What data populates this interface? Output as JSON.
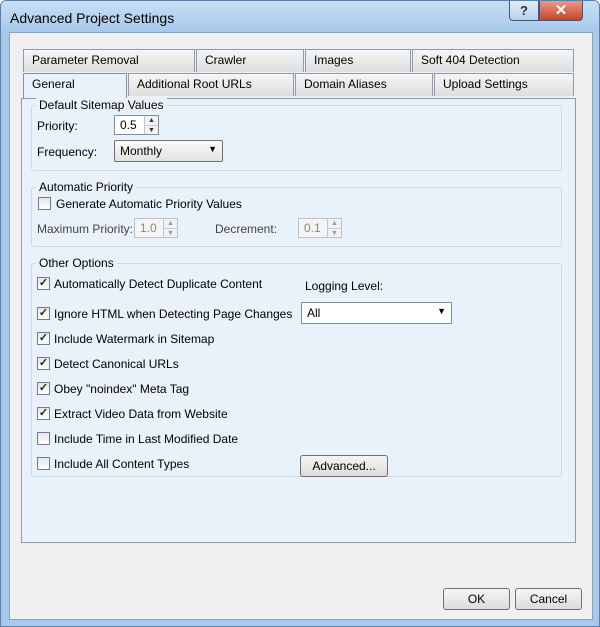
{
  "window": {
    "title": "Advanced Project Settings"
  },
  "titlebar": {
    "help_icon": "?",
    "close_icon": "✕"
  },
  "tabs": {
    "row_back": [
      "Parameter Removal",
      "Crawler",
      "Images",
      "Soft 404 Detection"
    ],
    "row_front": [
      "General",
      "Additional Root URLs",
      "Domain Aliases",
      "Upload Settings"
    ],
    "active": "General"
  },
  "default_sitemap": {
    "label": "Default Sitemap Values",
    "priority_label": "Priority:",
    "priority_value": "0.5",
    "frequency_label": "Frequency:",
    "frequency_value": "Monthly"
  },
  "automatic_priority": {
    "label": "Automatic Priority",
    "generate_label": "Generate Automatic Priority Values",
    "generate_checked": false,
    "max_priority_label": "Maximum Priority:",
    "max_priority_value": "1.0",
    "decrement_label": "Decrement:",
    "decrement_value": "0.1"
  },
  "other_options": {
    "label": "Other Options",
    "items": [
      {
        "label": "Automatically Detect Duplicate Content",
        "checked": true
      },
      {
        "label": "Ignore HTML when Detecting Page Changes",
        "checked": true
      },
      {
        "label": "Include Watermark in Sitemap",
        "checked": true
      },
      {
        "label": "Detect Canonical URLs",
        "checked": true
      },
      {
        "label": "Obey \"noindex\" Meta Tag",
        "checked": true
      },
      {
        "label": "Extract Video Data from Website",
        "checked": true
      },
      {
        "label": "Include Time in Last Modified Date",
        "checked": false
      },
      {
        "label": "Include All Content Types",
        "checked": false
      }
    ],
    "logging_label": "Logging Level:",
    "logging_value": "All",
    "advanced_label": "Advanced..."
  },
  "footer": {
    "ok_label": "OK",
    "cancel_label": "Cancel"
  },
  "symbols": {
    "check": "✓",
    "caret": "▼",
    "up": "▲",
    "down": "▼"
  }
}
